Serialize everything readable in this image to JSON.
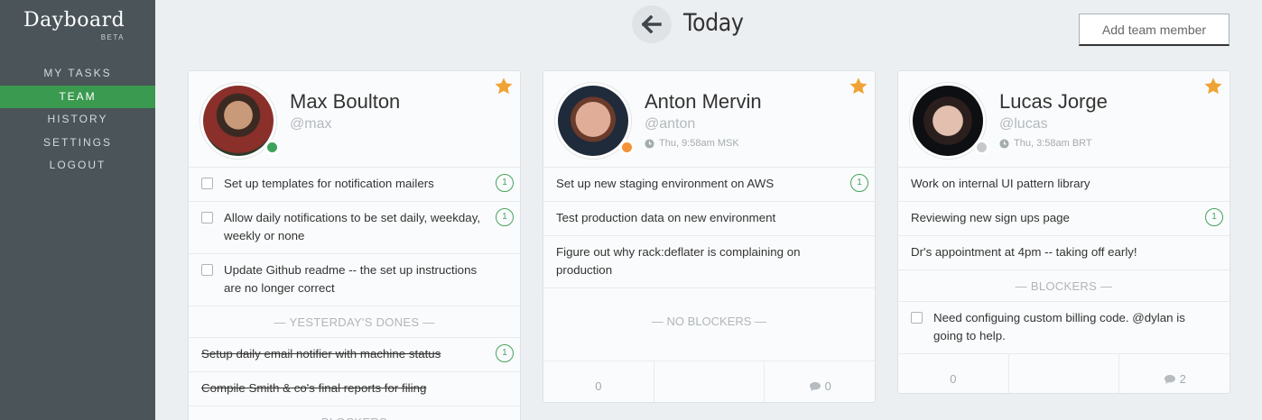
{
  "app": {
    "logo": "Dayboard",
    "beta": "BETA"
  },
  "sidebar": {
    "items": [
      {
        "label": "MY TASKS"
      },
      {
        "label": "TEAM"
      },
      {
        "label": "HISTORY"
      },
      {
        "label": "SETTINGS"
      },
      {
        "label": "LOGOUT"
      }
    ]
  },
  "header": {
    "title": "Today",
    "add_button": "Add team member"
  },
  "colors": {
    "sidebar": "#4a5459",
    "active": "#3a9a4f",
    "star": "#f0a335",
    "badge": "#46a35e",
    "online": "#3da35a",
    "away": "#f3923a",
    "offline": "#c5c9cc"
  },
  "members": [
    {
      "name": "Max Boulton",
      "handle": "@max",
      "local_time": "",
      "tasks": [
        {
          "text": "Set up templates for notification mailers",
          "badge": "1"
        },
        {
          "text": "Allow daily notifications to be set daily, weekday, weekly or none",
          "badge": "1"
        },
        {
          "text": "Update Github readme -- the set up instructions are no longer correct",
          "badge": ""
        }
      ],
      "yesterday_label": "— YESTERDAY'S DONES —",
      "yesterday": [
        {
          "text": "Setup daily email notifier with machine status",
          "badge": "1"
        },
        {
          "text": "Compile Smith & co's final reports for filing",
          "badge": ""
        }
      ],
      "blockers_label": "— BLOCKERS —"
    },
    {
      "name": "Anton Mervin",
      "handle": "@anton",
      "local_time": "Thu, 9:58am MSK",
      "tasks": [
        {
          "text": "Set up new staging environment on AWS",
          "badge": "1"
        },
        {
          "text": "Test production data on new environment",
          "badge": ""
        },
        {
          "text": "Figure out why rack:deflater is complaining on production",
          "badge": ""
        }
      ],
      "no_blockers_label": "— NO BLOCKERS —",
      "footer": {
        "count": "0",
        "comments": "0"
      }
    },
    {
      "name": "Lucas Jorge",
      "handle": "@lucas",
      "local_time": "Thu, 3:58am BRT",
      "tasks": [
        {
          "text": "Work on internal UI pattern library",
          "badge": ""
        },
        {
          "text": "Reviewing new sign ups page",
          "badge": "1"
        },
        {
          "text": "Dr's appointment at 4pm -- taking off early!",
          "badge": ""
        }
      ],
      "blockers_label": "— BLOCKERS —",
      "blockers": [
        {
          "text": "Need configuing custom billing code. @dylan is going to help."
        }
      ],
      "footer": {
        "count": "0",
        "comments": "2"
      }
    }
  ]
}
